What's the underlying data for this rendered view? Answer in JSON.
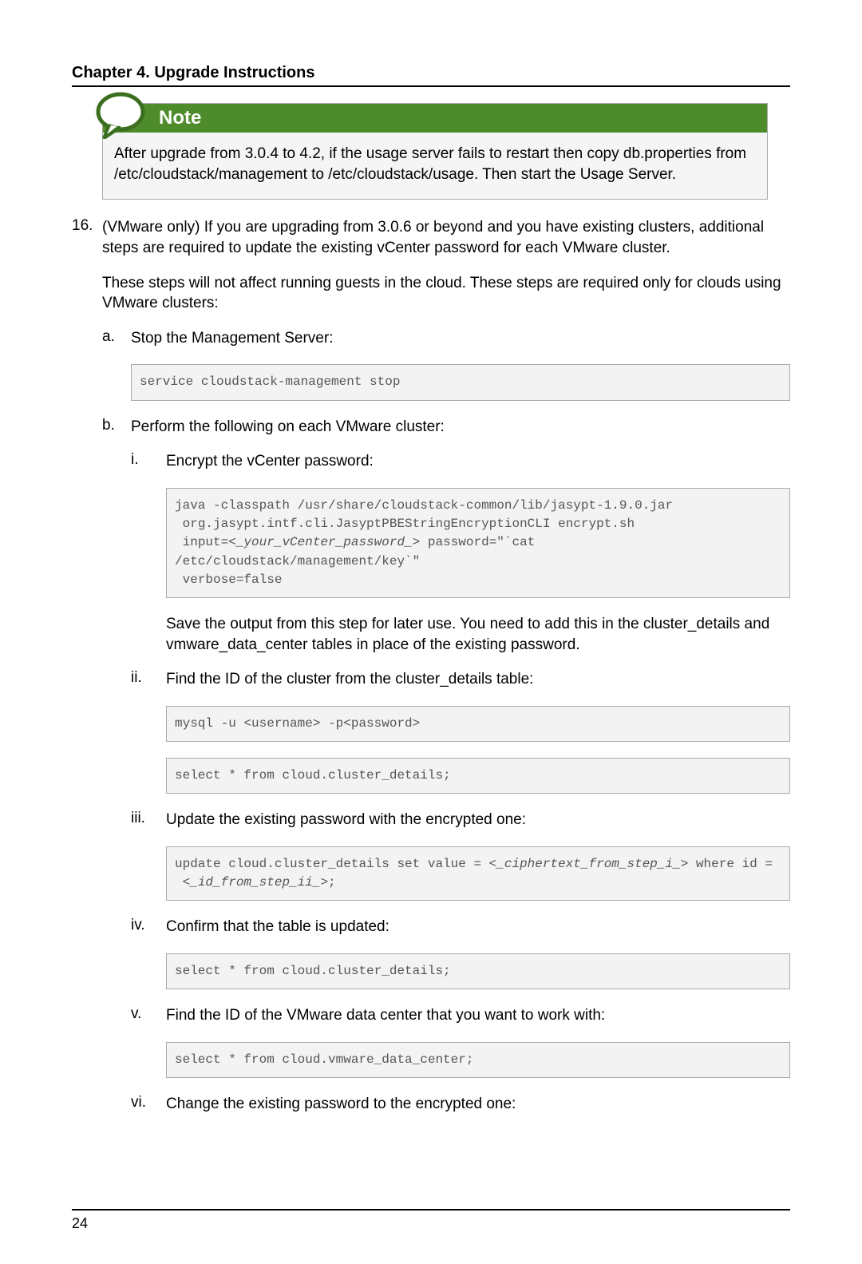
{
  "chapter": "Chapter 4. Upgrade Instructions",
  "pageNumber": "24",
  "note": {
    "title": "Note",
    "body": "After upgrade from 3.0.4 to 4.2, if the usage server fails to restart then copy db.properties from /etc/cloudstack/management to /etc/cloudstack/usage. Then start the Usage Server."
  },
  "step16": {
    "num": "16.",
    "p1": "(VMware only) If you are upgrading from 3.0.6 or beyond and you have existing clusters, additional steps are required to update the existing vCenter password for each VMware cluster.",
    "p2": "These steps will not affect running guests in the cloud. These steps are required only for clouds using VMware clusters:",
    "a": {
      "num": "a.",
      "text": "Stop the Management Server:",
      "code": "service cloudstack-management stop"
    },
    "b": {
      "num": "b.",
      "text": "Perform the following on each VMware cluster:",
      "i": {
        "num": "i.",
        "text": "Encrypt the vCenter password:",
        "code_pre1": "java -classpath /usr/share/cloudstack-common/lib/jasypt-1.9.0.jar\n org.jasypt.intf.cli.JasyptPBEStringEncryptionCLI encrypt.sh\n input=<",
        "code_ital1": "_your_vCenter_password_",
        "code_post1": "> password=\"`cat /etc/cloudstack/management/key`\"\n verbose=false",
        "after": "Save the output from this step for later use. You need to add this in the cluster_details and vmware_data_center tables in place of the existing password."
      },
      "ii": {
        "num": "ii.",
        "text": "Find the ID of the cluster from the cluster_details table:",
        "code1": "mysql -u <username> -p<password>",
        "code2": "select * from cloud.cluster_details;"
      },
      "iii": {
        "num": "iii.",
        "text": "Update the existing password with the encrypted one:",
        "code_pre": "update cloud.cluster_details set value = <",
        "code_ital1": "_ciphertext_from_step_i_",
        "code_mid": "> where id =\n <",
        "code_ital2": "_id_from_step_ii_",
        "code_post": ">;"
      },
      "iv": {
        "num": "iv.",
        "text": "Confirm that the table is updated:",
        "code": "select * from cloud.cluster_details;"
      },
      "v": {
        "num": "v.",
        "text": "Find the ID of the VMware data center that you want to work with:",
        "code": "select * from cloud.vmware_data_center;"
      },
      "vi": {
        "num": "vi.",
        "text": "Change the existing password to the encrypted one:"
      }
    }
  }
}
